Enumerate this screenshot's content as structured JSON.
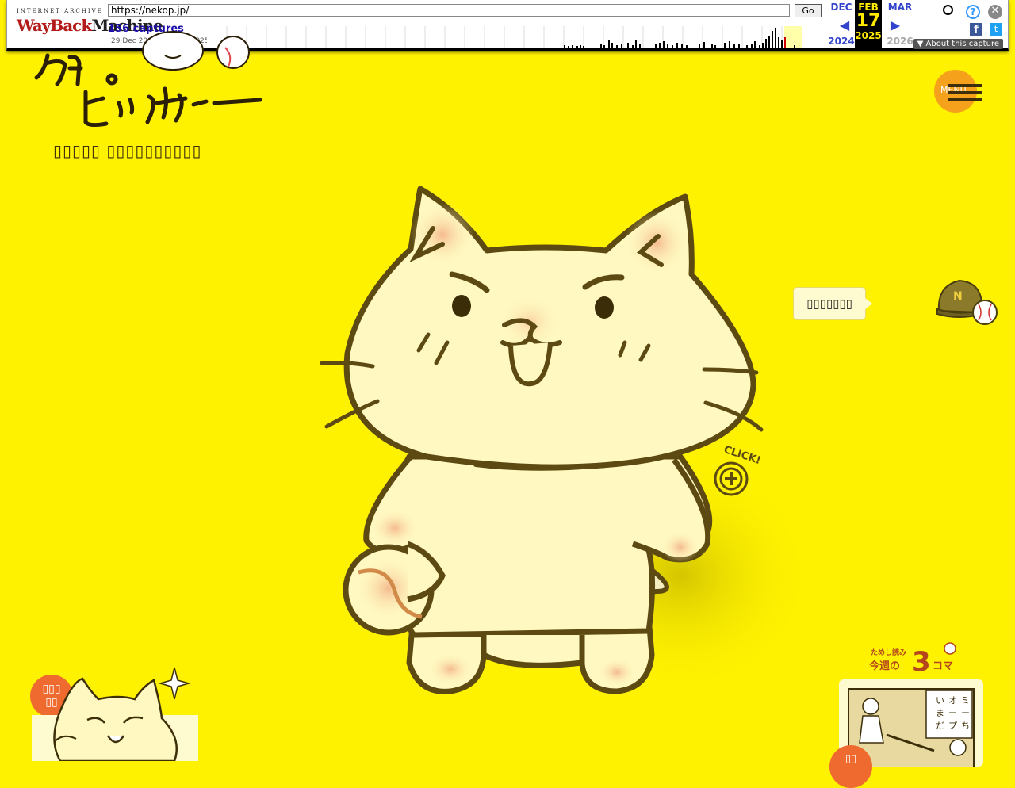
{
  "wayback": {
    "ia_label": "INTERNET ARCHIVE",
    "logo_wayback": "WayBack",
    "logo_machine": "Machine",
    "url": "https://nekop.jp/",
    "go_label": "Go",
    "captures": "156 captures",
    "range": "29 Dec 2013 - 26 Sep 2025",
    "prev_month": "DEC",
    "prev_year": "2024",
    "cur_month": "FEB",
    "cur_day": "17",
    "cur_year": "2025",
    "next_month": "MAR",
    "next_year": "2026",
    "about": "▼ About this capture"
  },
  "site": {
    "tagline": "▯▯▯▯▯ ▯▯▯▯▯▯▯▯▯▯",
    "menu_label": "MENU",
    "bubble_text": "▯▯▯▯▯▯▯",
    "click_label": "CLICK!",
    "new_button": "▯▯▯\n▯▯",
    "trial_small": "ためし読み",
    "trial_big": "今週の",
    "trial_num": "3",
    "trial_unit": "コマ",
    "bottom_circle": "▯▯"
  },
  "colors": {
    "background": "#fff200",
    "accent_orange": "#ef6a2f",
    "menu_orange": "#f5a11c",
    "outline_brown": "#5c4a12",
    "cat_fill": "#fff8c0"
  }
}
